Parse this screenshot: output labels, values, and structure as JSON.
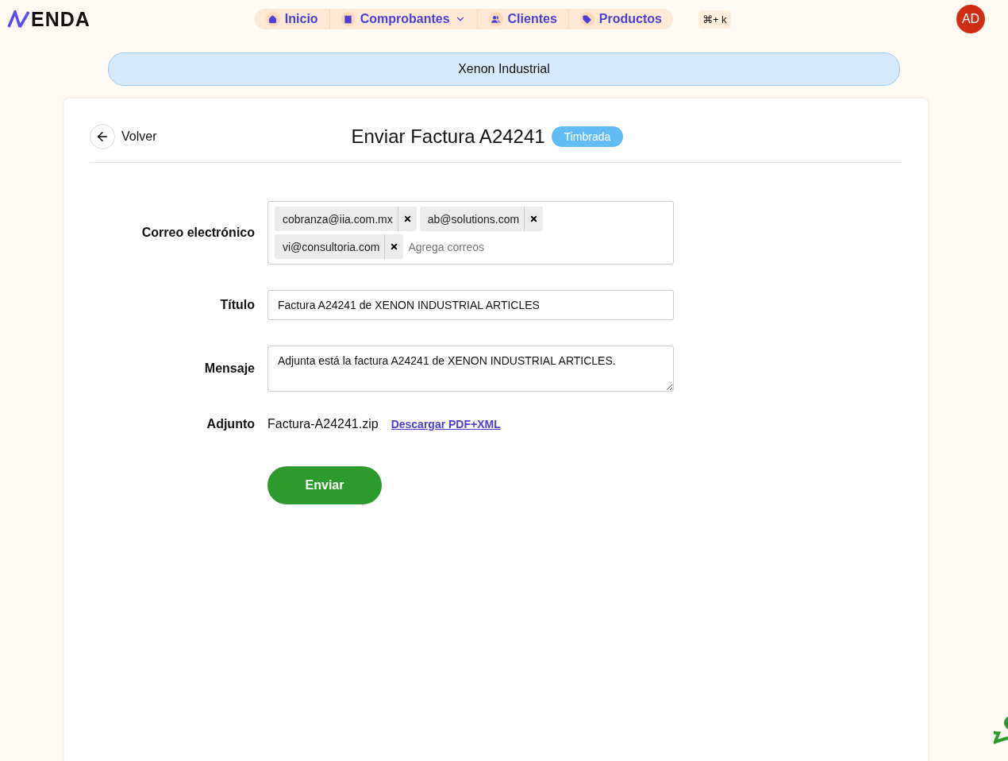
{
  "brand": {
    "logo": "ENDA"
  },
  "nav": [
    {
      "label": "Inicio",
      "dropdown": false
    },
    {
      "label": "Comprobantes",
      "dropdown": true
    },
    {
      "label": "Clientes",
      "dropdown": false
    },
    {
      "label": "Productos",
      "dropdown": false
    }
  ],
  "shortcut": "⌘+ k",
  "avatar": "AD",
  "company": "Xenon Industrial",
  "back": "Volver",
  "title": "Enviar Factura A24241",
  "status": "Timbrada",
  "form": {
    "email_label": "Correo electrónico",
    "emails": [
      "cobranza@iia.com.mx",
      "ab@solutions.com",
      "vi@consultoria.com"
    ],
    "email_placeholder": "Agrega correos",
    "title_label": "Título",
    "title_value": "Factura A24241 de XENON INDUSTRIAL ARTICLES",
    "message_label": "Mensaje",
    "message_value": "Adjunta está la factura A24241 de XENON INDUSTRIAL ARTICLES.",
    "attachment_label": "Adjunto",
    "attachment_name": "Factura-A24241.zip",
    "download_link": "Descargar PDF+XML",
    "submit": "Enviar"
  }
}
